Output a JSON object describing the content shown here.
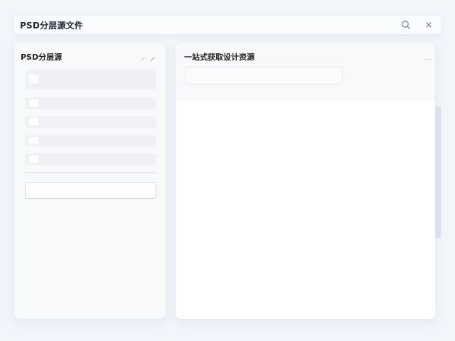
{
  "window": {
    "title": "PSD分层源文件",
    "search_icon": "search-icon",
    "close_icon": "close-icon"
  },
  "left_panel": {
    "title": "PSD分层源",
    "tool_icons": [
      "edit-icon",
      "pencil-icon"
    ],
    "item_count": 5,
    "input": {
      "value": "",
      "placeholder": ""
    }
  },
  "right_panel": {
    "title": "一站式获取设计资源",
    "more_icon": "more-icon",
    "search_field": {
      "value": "",
      "placeholder": ""
    }
  },
  "colors": {
    "background": "#f2f5fa",
    "panel": "#f8f9fb",
    "skeleton": "#eff1f4",
    "input_border_focus": "#cbd8e8",
    "scrollbar": "#d9e1ec"
  }
}
